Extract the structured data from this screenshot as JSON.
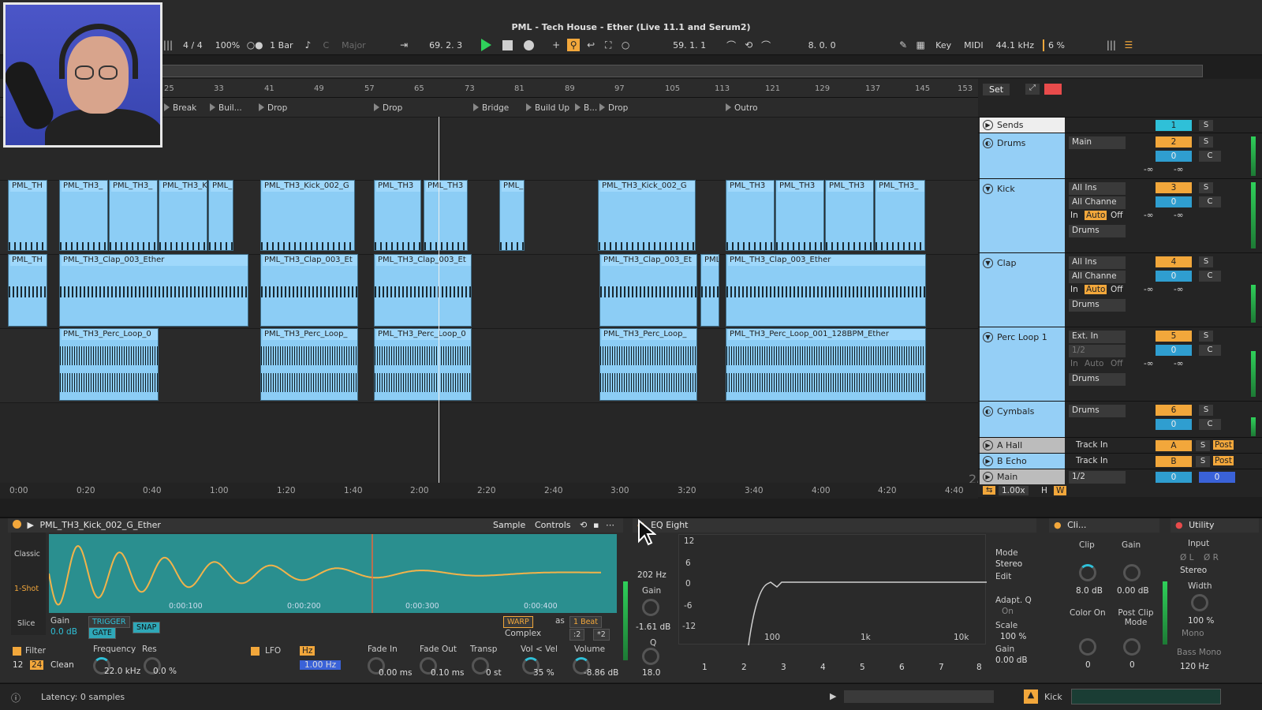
{
  "window": {
    "title": "PML - Tech House - Ether (Live 11.1 and Serum2)"
  },
  "transport": {
    "signature": "4 / 4",
    "zoom": "100%",
    "quantize": "1 Bar",
    "key_root": "C",
    "scale": "Major",
    "position": "69.  2.  3",
    "loop_start": "59.  1.  1",
    "loop_length": "8.  0.  0",
    "key_btn": "Key",
    "midi_btn": "MIDI",
    "sample_rate": "44.1 kHz",
    "cpu": "6 %"
  },
  "ruler": {
    "bars": [
      "25",
      "33",
      "41",
      "49",
      "57",
      "65",
      "73",
      "81",
      "89",
      "97",
      "105",
      "113",
      "121",
      "129",
      "137",
      "145",
      "153"
    ]
  },
  "locators": [
    "Break",
    "Buil...",
    "Drop",
    "Drop",
    "Bridge",
    "Build Up",
    "B...",
    "Drop",
    "Outro"
  ],
  "clips": {
    "kick": [
      "PML_TH",
      "PML_TH3_",
      "PML_TH3_",
      "PML_TH3_K",
      "PML_",
      "PML_TH3_Kick_002_G",
      "PML_TH3",
      "PML_TH3",
      "PML_",
      "PML_TH3_Kick_002_G",
      "PML_TH3",
      "PML_TH3",
      "PML_TH3",
      "PML_TH3_"
    ],
    "clap": [
      "PML_TH",
      "PML_TH3_Clap_003_Ether",
      "PML_TH3_Clap_003_Et",
      "PML_TH3_Clap_003_Et",
      "PML_TH3_Clap_003_Et",
      "PML",
      "PML_TH3_Clap_003_Ether"
    ],
    "perc": [
      "PML_TH3_Perc_Loop_0",
      "PML_TH3_Perc_Loop_",
      "PML_TH3_Perc_Loop_0",
      "PML_TH3_Perc_Loop_",
      "PML_TH3_Perc_Loop_001_128BPM_Ether"
    ]
  },
  "timeline": {
    "times": [
      "0:00",
      "0:20",
      "0:40",
      "1:00",
      "1:20",
      "1:40",
      "2:00",
      "2:20",
      "2:40",
      "3:00",
      "3:20",
      "3:40",
      "4:00",
      "4:20",
      "4:40"
    ],
    "page": "2/1"
  },
  "mixer": {
    "set_btn": "Set",
    "tracks": [
      {
        "name": "Sends",
        "number": "1"
      },
      {
        "name": "Drums",
        "route": "Main",
        "number": "2",
        "vol": "0",
        "pan": "C"
      },
      {
        "name": "Kick",
        "in": "All Ins",
        "ch": "All Channe",
        "out": "Drums",
        "number": "3",
        "vol": "0",
        "pan": "C"
      },
      {
        "name": "Clap",
        "in": "All Ins",
        "ch": "All Channe",
        "out": "Drums",
        "number": "4",
        "vol": "0",
        "pan": "C"
      },
      {
        "name": "Perc Loop 1",
        "in": "Ext. In",
        "ch": "1/2",
        "out": "Drums",
        "number": "5",
        "vol": "0",
        "pan": "C"
      },
      {
        "name": "Cymbals",
        "out": "Drums",
        "number": "6",
        "vol": "0",
        "pan": "C"
      },
      {
        "name": "A Hall",
        "in": "Track In",
        "number": "A",
        "post": "Post"
      },
      {
        "name": "B Echo",
        "in": "Track In",
        "number": "B",
        "post": "Post"
      },
      {
        "name": "Main",
        "out": "1/2",
        "number": "0",
        "vol": "0"
      }
    ],
    "monitor_in": "In",
    "monitor_auto": "Auto",
    "monitor_off": "Off",
    "minus_inf": "-∞",
    "solo": "S",
    "tempo_scale": "1.00x",
    "h_btn": "H",
    "w_btn": "W"
  },
  "simpler": {
    "name": "PML_TH3_Kick_002_G_Ether",
    "tab_sample": "Sample",
    "tab_controls": "Controls",
    "mode_classic": "Classic",
    "mode_oneshot": "1-Shot",
    "mode_slice": "Slice",
    "gain_label": "Gain",
    "gain": "0.0 dB",
    "trigger": "TRIGGER",
    "gate": "GATE",
    "snap": "SNAP",
    "warp": "WARP",
    "as": "as",
    "beat": "1 Beat",
    "complex": "Complex",
    "div": ":2",
    "mul": "*2",
    "times": [
      "0:00:100",
      "0:00:200",
      "0:00:300",
      "0:00:400"
    ],
    "filter": "Filter",
    "freq_label": "Frequency",
    "res_label": "Res",
    "freq": "22.0 kHz",
    "res": "0.0 %",
    "f12": "12",
    "f24": "24",
    "clean": "Clean",
    "lfo": "LFO",
    "hz": "Hz",
    "lfo_rate": "1.00 Hz",
    "fadein_label": "Fade In",
    "fadeout_label": "Fade Out",
    "transp_label": "Transp",
    "volvel_label": "Vol < Vel",
    "volume_label": "Volume",
    "fadein": "0.00 ms",
    "fadeout": "0.10 ms",
    "transp": "0 st",
    "volvel": "35 %",
    "volume": "-8.86 dB"
  },
  "eq": {
    "name": "EQ Eight",
    "freq": "202 Hz",
    "gain_label": "Gain",
    "gain": "-1.61 dB",
    "q_label": "Q",
    "q": "18.0",
    "db_ticks": [
      "12",
      "6",
      "0",
      "-6",
      "-12"
    ],
    "freq_ticks": [
      "100",
      "1k",
      "10k"
    ],
    "bands": [
      "1",
      "2",
      "3",
      "4",
      "5",
      "6",
      "7",
      "8"
    ],
    "mode_label": "Mode",
    "mode": "Stereo",
    "edit_label": "Edit",
    "adaptq_label": "Adapt. Q",
    "adaptq": "On",
    "scale_label": "Scale",
    "scale": "100 %",
    "gain2_label": "Gain",
    "gain2": "0.00 dB"
  },
  "clipgain": {
    "name": "Cli...",
    "clip": "Clip",
    "gain": "Gain",
    "clip_val": "8.0 dB",
    "gain_val": "0.00 dB",
    "color_on": "Color On",
    "post_clip": "Post Clip Mode",
    "k1": "0",
    "k2": "0"
  },
  "utility": {
    "name": "Utility",
    "input": "Input",
    "phase_l": "Ø L",
    "phase_r": "Ø R",
    "stereo": "Stereo",
    "width": "Width",
    "width_val": "100 %",
    "bass_mono": "Bass Mono",
    "mono": "Mono",
    "bass_hz": "120 Hz"
  },
  "status": {
    "latency": "Latency: 0 samples",
    "track": "Kick"
  }
}
